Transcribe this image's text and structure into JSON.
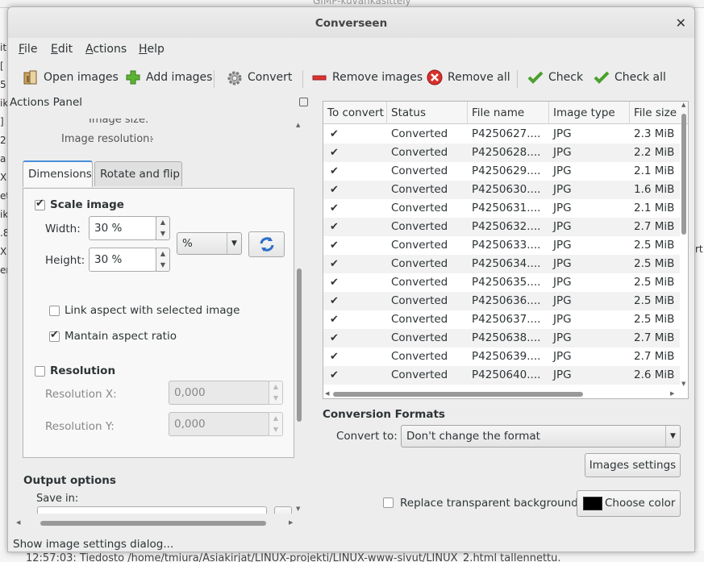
{
  "window": {
    "title": "Converseen"
  },
  "menu": [
    {
      "label": "File",
      "key": "F",
      "rest": "ile"
    },
    {
      "label": "Edit",
      "key": "E",
      "rest": "dit"
    },
    {
      "label": "Actions",
      "key": "A",
      "rest": "ctions"
    },
    {
      "label": "Help",
      "key": "H",
      "rest": "elp"
    }
  ],
  "toolbar": {
    "open_images": "Open images",
    "add_images": "Add images",
    "convert": "Convert",
    "remove_images": "Remove images",
    "remove_all": "Remove all",
    "check": "Check",
    "check_all": "Check all"
  },
  "actions_panel": {
    "title": "Actions Panel",
    "image_size_label": "Image size:",
    "image_resolution_label": "Image resolution:",
    "image_resolution_value": "-",
    "tabs": [
      "Dimensions",
      "Rotate and flip"
    ],
    "scale_image": {
      "label": "Scale image",
      "checked": true
    },
    "width_label": "Width:",
    "width_value": "30 %",
    "height_label": "Height:",
    "height_value": "30 %",
    "unit": "%",
    "link_aspect": {
      "label": "Link aspect with selected image",
      "checked": false
    },
    "maintain_aspect": {
      "label": "Mantain aspect ratio",
      "checked": true
    },
    "resolution": {
      "label": "Resolution",
      "checked": false
    },
    "resolution_x_label": "Resolution X:",
    "resolution_x_value": "0,000",
    "resolution_y_label": "Resolution Y:",
    "resolution_y_value": "0,000",
    "output_options": "Output options",
    "save_in": "Save in:"
  },
  "table": {
    "columns": [
      "To convert",
      "Status",
      "File name",
      "Image type",
      "File size"
    ],
    "rows": [
      {
        "checked": true,
        "status": "Converted",
        "file": "P4250627....",
        "type": "JPG",
        "size": "2.3 MiB"
      },
      {
        "checked": true,
        "status": "Converted",
        "file": "P4250628....",
        "type": "JPG",
        "size": "2.2 MiB"
      },
      {
        "checked": true,
        "status": "Converted",
        "file": "P4250629....",
        "type": "JPG",
        "size": "2.1 MiB"
      },
      {
        "checked": true,
        "status": "Converted",
        "file": "P4250630....",
        "type": "JPG",
        "size": "1.6 MiB"
      },
      {
        "checked": true,
        "status": "Converted",
        "file": "P4250631....",
        "type": "JPG",
        "size": "2.1 MiB"
      },
      {
        "checked": true,
        "status": "Converted",
        "file": "P4250632....",
        "type": "JPG",
        "size": "2.7 MiB"
      },
      {
        "checked": true,
        "status": "Converted",
        "file": "P4250633....",
        "type": "JPG",
        "size": "2.5 MiB"
      },
      {
        "checked": true,
        "status": "Converted",
        "file": "P4250634....",
        "type": "JPG",
        "size": "2.5 MiB"
      },
      {
        "checked": true,
        "status": "Converted",
        "file": "P4250635....",
        "type": "JPG",
        "size": "2.5 MiB"
      },
      {
        "checked": true,
        "status": "Converted",
        "file": "P4250636....",
        "type": "JPG",
        "size": "2.5 MiB"
      },
      {
        "checked": true,
        "status": "Converted",
        "file": "P4250637....",
        "type": "JPG",
        "size": "2.5 MiB"
      },
      {
        "checked": true,
        "status": "Converted",
        "file": "P4250638....",
        "type": "JPG",
        "size": "2.7 MiB"
      },
      {
        "checked": true,
        "status": "Converted",
        "file": "P4250639....",
        "type": "JPG",
        "size": "2.7 MiB"
      },
      {
        "checked": true,
        "status": "Converted",
        "file": "P4250640....",
        "type": "JPG",
        "size": "2.6 MiB"
      }
    ]
  },
  "conversion": {
    "title": "Conversion Formats",
    "convert_to_label": "Convert to:",
    "convert_to_value": "Don't change the format",
    "images_settings": "Images settings",
    "replace_bg": {
      "label": "Replace transparent background",
      "checked": false
    },
    "choose_color": "Choose color",
    "color_swatch": "#000000"
  },
  "statusbar": {
    "text": "Show image settings dialog..."
  },
  "background": {
    "top_title": "GIMP-kuvankäsittely",
    "bottom_text": "12:57:03: Tiedosto /home/tmiura/Asiakirjat/LINUX-projekti/LINUX-www-sivut/LINUX_2.html tallennettu.",
    "left_fragments": [
      "it",
      "[",
      "5",
      "ik",
      "]",
      "2",
      "a",
      "X",
      "et",
      "ik",
      ".8",
      "X",
      "er"
    ],
    "right_fragment": "rt"
  }
}
